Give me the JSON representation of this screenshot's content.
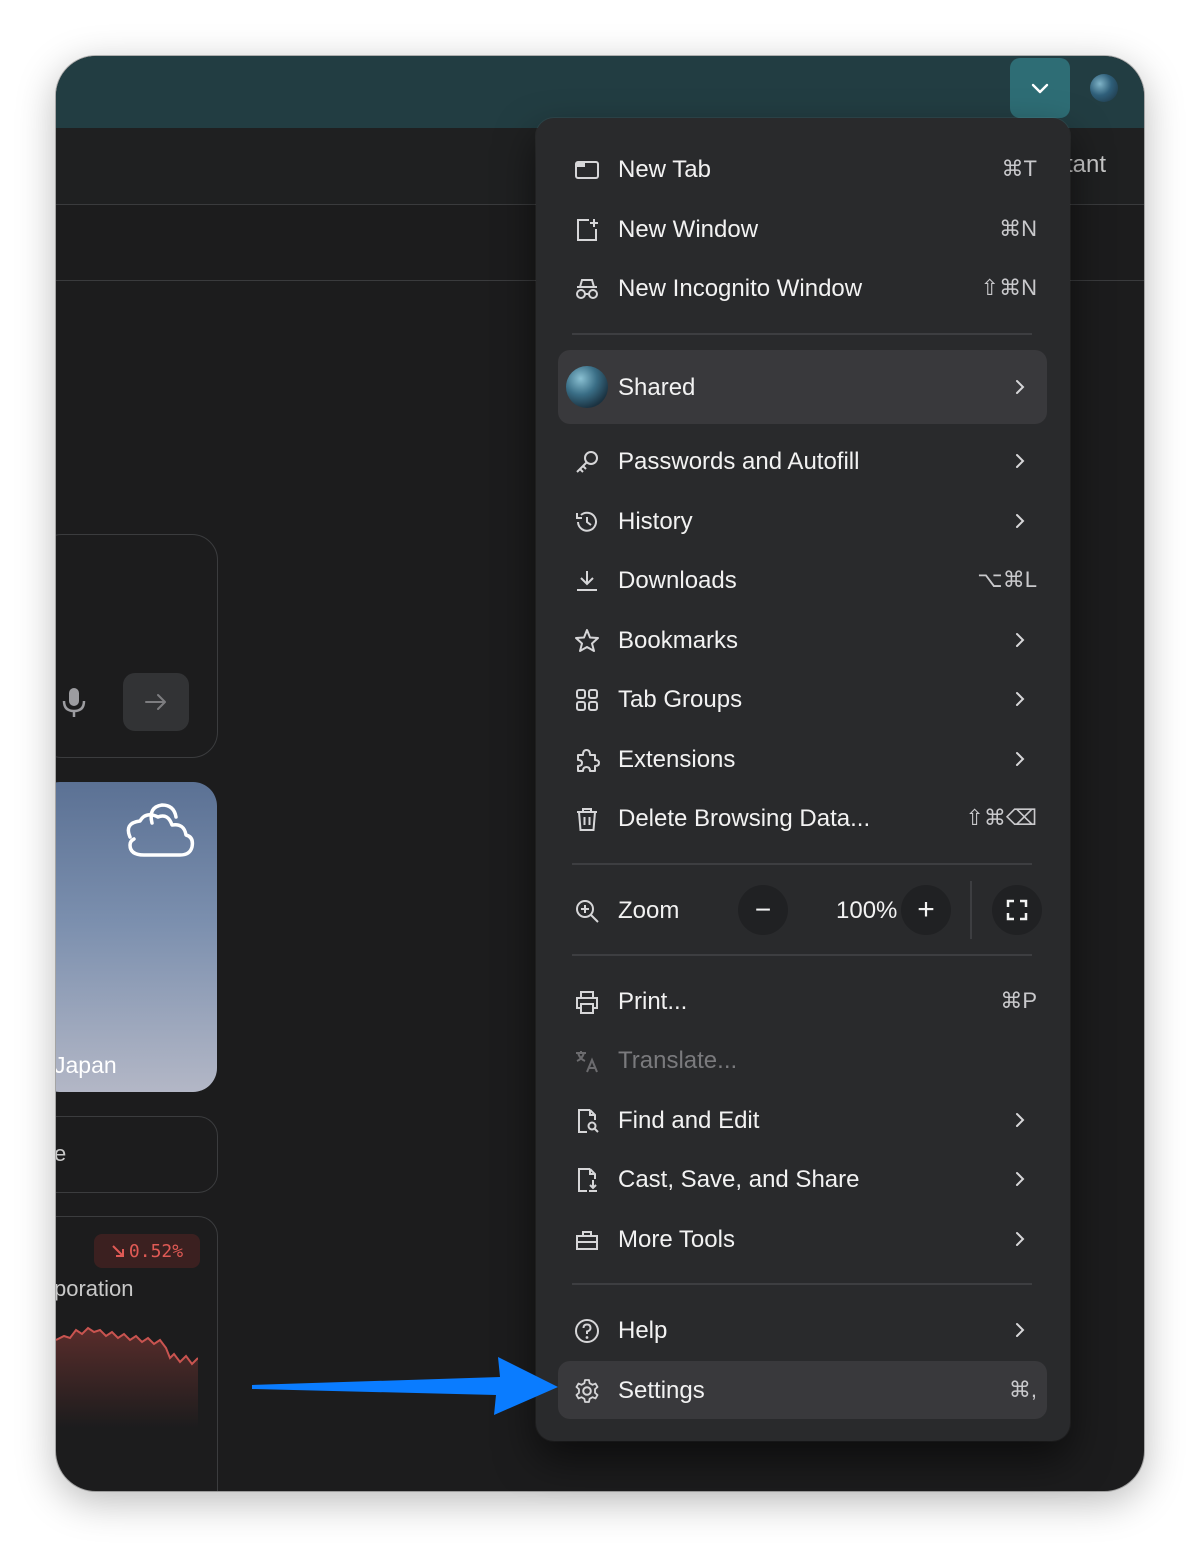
{
  "page": {
    "assistant_text": "tant",
    "weather_location": "Japan",
    "small_card_text": "e",
    "stock": {
      "change": "0.52%",
      "name": "poration"
    }
  },
  "menu": {
    "new_tab": {
      "label": "New Tab",
      "shortcut": "⌘T"
    },
    "new_window": {
      "label": "New Window",
      "shortcut": "⌘N"
    },
    "new_incognito": {
      "label": "New Incognito Window",
      "shortcut": "⇧⌘N"
    },
    "profile": {
      "label": "Shared"
    },
    "passwords": {
      "label": "Passwords and Autofill"
    },
    "history": {
      "label": "History"
    },
    "downloads": {
      "label": "Downloads",
      "shortcut": "⌥⌘L"
    },
    "bookmarks": {
      "label": "Bookmarks"
    },
    "tab_groups": {
      "label": "Tab Groups"
    },
    "extensions": {
      "label": "Extensions"
    },
    "delete_data": {
      "label": "Delete Browsing Data...",
      "shortcut": "⇧⌘⌫"
    },
    "zoom": {
      "label": "Zoom",
      "value": "100%",
      "decrease": "−",
      "increase": "+"
    },
    "print": {
      "label": "Print...",
      "shortcut": "⌘P"
    },
    "translate": {
      "label": "Translate..."
    },
    "find_edit": {
      "label": "Find and Edit"
    },
    "cast_save": {
      "label": "Cast, Save, and Share"
    },
    "more_tools": {
      "label": "More Tools"
    },
    "help": {
      "label": "Help"
    },
    "settings": {
      "label": "Settings",
      "shortcut": "⌘,"
    }
  },
  "colors": {
    "titlebar": "#223d42",
    "menu_background": "#292a2c",
    "highlight": "#39393c",
    "annotation_arrow": "#0a7cff",
    "stock_down": "#e05a55"
  },
  "annotation": {
    "type": "arrow",
    "points_to": "settings"
  }
}
